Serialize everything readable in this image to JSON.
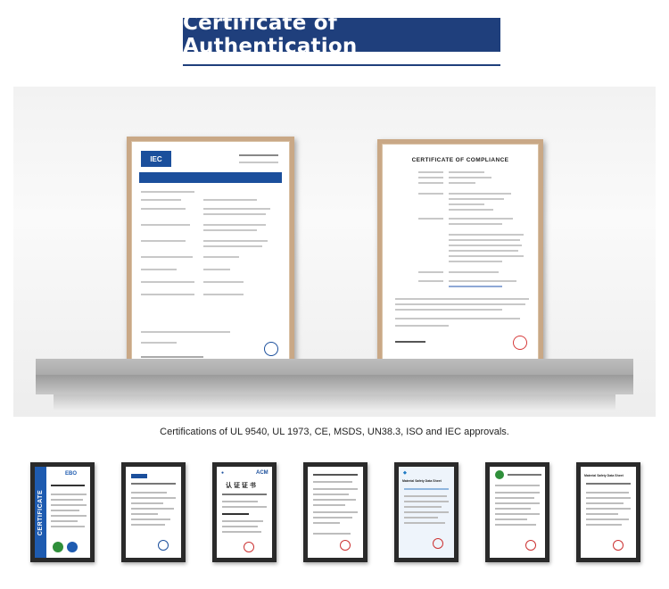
{
  "header": {
    "title": "Certificate of Authentication"
  },
  "shelf_certificates": {
    "left_logo": "IEC",
    "right_title": "CERTIFICATE OF COMPLIANCE"
  },
  "caption": "Certifications of UL 9540, UL 1973, CE, MSDS, UN38.3, ISO and IEC approvals.",
  "thumbnails": {
    "t1_side_text": "CERTIFICATE",
    "t1_logo": "EBO",
    "t3_title": "认 证 证 书",
    "t3_logo": "ACM",
    "t5_title": "Material Safety Data Sheet",
    "t7_title": "Material Safety Data Sheet"
  },
  "colors": {
    "banner": "#1f3f7c",
    "frame_wood": "#c9a886",
    "thumb_frame": "#2a2a2a",
    "iec_blue": "#1b4f9c"
  }
}
